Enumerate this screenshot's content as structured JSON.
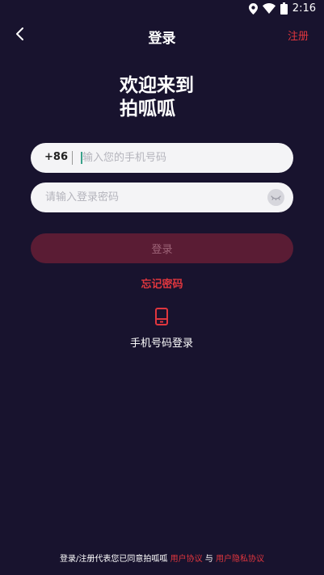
{
  "status": {
    "time": "2:16"
  },
  "header": {
    "title": "登录",
    "register": "注册"
  },
  "welcome": {
    "line1": "欢迎来到",
    "line2": "拍呱呱"
  },
  "phone_field": {
    "country_code": "+86",
    "placeholder": "输入您的手机号码"
  },
  "password_field": {
    "placeholder": "请输入登录密码"
  },
  "login_button": "登录",
  "forgot_password": "忘记密码",
  "phone_login": {
    "label": "手机号码登录",
    "icon": "phone-icon"
  },
  "agreement": {
    "prefix": "登录/注册代表您已同意拍呱呱",
    "user_agreement": "用户协议",
    "conjunction": "与",
    "privacy_agreement": "用户隐私协议"
  },
  "colors": {
    "background": "#18132e",
    "accent": "#e0363e",
    "button_disabled": "#5a1c34"
  }
}
